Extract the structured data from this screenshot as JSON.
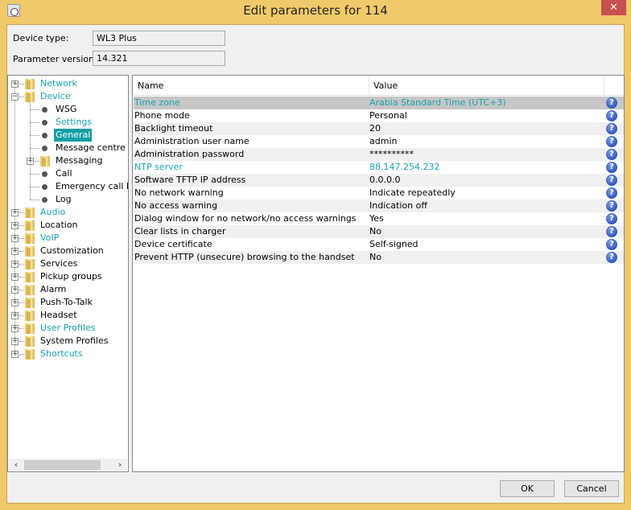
{
  "window": {
    "title": "Edit parameters for 114",
    "close_label": "✕"
  },
  "device_info": {
    "device_type_label": "Device type:",
    "device_type_value": "WL3 Plus",
    "param_version_label": "Parameter version:",
    "param_version_value": "14.321"
  },
  "tree": {
    "items": [
      {
        "label": "Network",
        "level": 0,
        "type": "folder",
        "expander": "+",
        "teal": true
      },
      {
        "label": "Device",
        "level": 0,
        "type": "folder",
        "expander": "−",
        "teal": true
      },
      {
        "label": "WSG",
        "level": 1,
        "type": "leaf",
        "teal": false
      },
      {
        "label": "Settings",
        "level": 1,
        "type": "leaf",
        "teal": true
      },
      {
        "label": "General",
        "level": 1,
        "type": "leaf",
        "selected": true
      },
      {
        "label": "Message centre",
        "level": 1,
        "type": "leaf",
        "teal": false
      },
      {
        "label": "Messaging",
        "level": 1,
        "type": "folder",
        "expander": "+",
        "teal": false
      },
      {
        "label": "Call",
        "level": 1,
        "type": "leaf",
        "teal": false
      },
      {
        "label": "Emergency call Num",
        "level": 1,
        "type": "leaf",
        "teal": false
      },
      {
        "label": "Log",
        "level": 1,
        "type": "leaf",
        "teal": false
      },
      {
        "label": "Audio",
        "level": 0,
        "type": "folder",
        "expander": "+",
        "teal": true
      },
      {
        "label": "Location",
        "level": 0,
        "type": "folder",
        "expander": "+",
        "teal": false
      },
      {
        "label": "VoIP",
        "level": 0,
        "type": "folder",
        "expander": "+",
        "teal": true
      },
      {
        "label": "Customization",
        "level": 0,
        "type": "folder",
        "expander": "+",
        "teal": false
      },
      {
        "label": "Services",
        "level": 0,
        "type": "folder",
        "expander": "+",
        "teal": false
      },
      {
        "label": "Pickup groups",
        "level": 0,
        "type": "folder",
        "expander": "+",
        "teal": false
      },
      {
        "label": "Alarm",
        "level": 0,
        "type": "folder",
        "expander": "+",
        "teal": false
      },
      {
        "label": "Push-To-Talk",
        "level": 0,
        "type": "folder",
        "expander": "+",
        "teal": false
      },
      {
        "label": "Headset",
        "level": 0,
        "type": "folder",
        "expander": "+",
        "teal": false
      },
      {
        "label": "User Profiles",
        "level": 0,
        "type": "folder",
        "expander": "+",
        "teal": true
      },
      {
        "label": "System Profiles",
        "level": 0,
        "type": "folder",
        "expander": "+",
        "teal": false
      },
      {
        "label": "Shortcuts",
        "level": 0,
        "type": "folder",
        "expander": "+",
        "teal": true
      }
    ],
    "scroll_left": "‹",
    "scroll_right": "›"
  },
  "grid": {
    "columns": [
      "Name",
      "Value"
    ],
    "rows": [
      {
        "name": "Time zone",
        "value": "Arabia Standard Time (UTC+3)",
        "teal": true,
        "selected": true
      },
      {
        "name": "Phone mode",
        "value": "Personal"
      },
      {
        "name": "Backlight timeout",
        "value": "20"
      },
      {
        "name": "Administration user name",
        "value": "admin"
      },
      {
        "name": "Administration password",
        "value": "**********"
      },
      {
        "name": "NTP server",
        "value": "88.147.254.232",
        "teal": true
      },
      {
        "name": "Software TFTP IP address",
        "value": "0.0.0.0"
      },
      {
        "name": "No network warning",
        "value": "Indicate repeatedly"
      },
      {
        "name": "No access warning",
        "value": "Indication off"
      },
      {
        "name": "Dialog window for no network/no access warnings",
        "value": "Yes"
      },
      {
        "name": "Clear lists in charger",
        "value": "No"
      },
      {
        "name": "Device certificate",
        "value": "Self-signed"
      },
      {
        "name": "Prevent HTTP (unsecure) browsing to the handset",
        "value": "No"
      }
    ],
    "help_glyph": "?"
  },
  "buttons": {
    "ok": "OK",
    "cancel": "Cancel"
  },
  "colors": {
    "frame": "#f0c96a",
    "accent_teal": "#17a2b0",
    "selection": "#149ea4",
    "close": "#c75050"
  }
}
